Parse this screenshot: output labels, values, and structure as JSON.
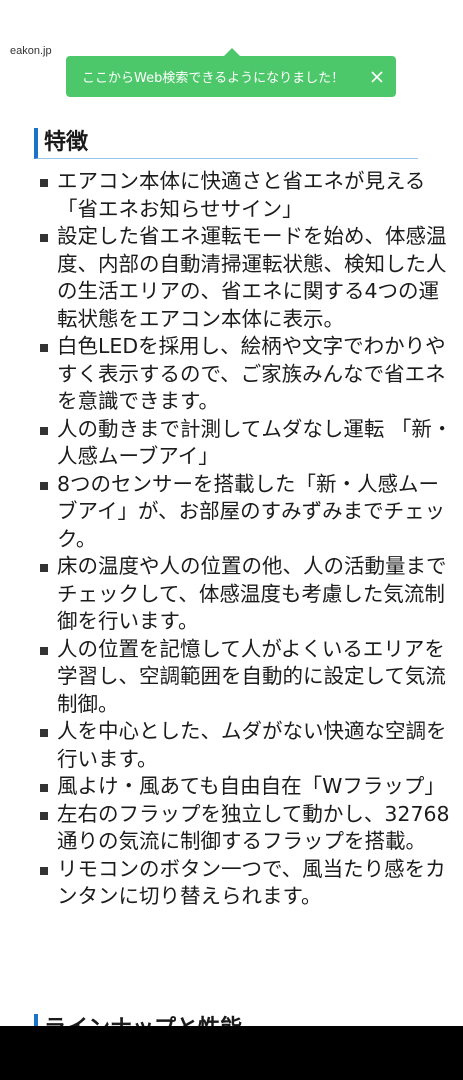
{
  "site": {
    "label": "eakon.jp"
  },
  "toast": {
    "message": "ここからWeb検索できるようになりました！",
    "close_icon": "close-icon",
    "color": "#4cc86a"
  },
  "sections": {
    "features_title": "特徴",
    "lineup_title": "ラインナップと性能"
  },
  "features": [
    "エアコン本体に快適さと省エネが見える「省エネお知らせサイン」",
    "設定した省エネ運転モードを始め、体感温度、内部の自動清掃運転状態、検知した人の生活エリアの、省エネに関する4つの運転状態をエアコン本体に表示。",
    "白色LEDを採用し、絵柄や文字でわかりやすく表示するので、ご家族みんなで省エネを意識できます。",
    "人の動きまで計測してムダなし運転 「新・人感ムーブアイ」",
    "8つのセンサーを搭載した「新・人感ムーブアイ」が、お部屋のすみずみまでチェック。",
    "床の温度や人の位置の他、人の活動量までチェックして、体感温度も考慮した気流制御を行います。",
    "人の位置を記憶して人がよくいるエリアを学習し、空調範囲を自動的に設定して気流制御。",
    "人を中心とした、ムダがない快適な空調を行います。",
    "風よけ・風あても自由自在「Wフラップ」",
    "左右のフラップを独立して動かし、32768通りの気流に制御するフラップを搭載。",
    "リモコンのボタン一つで、風当たり感をカンタンに切り替えられます。"
  ],
  "colors": {
    "accent": "#1a73c9"
  }
}
